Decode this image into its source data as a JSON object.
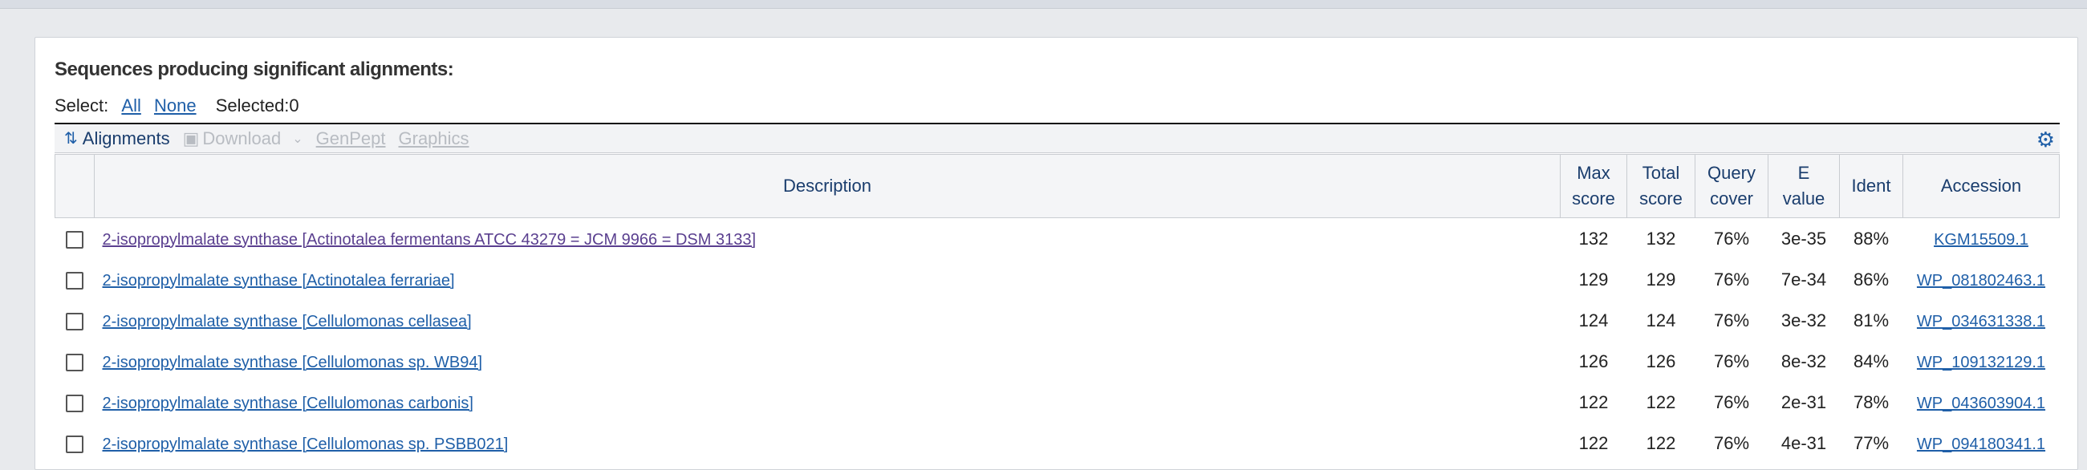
{
  "header": {
    "title": "Sequences producing significant alignments:"
  },
  "select": {
    "label": "Select:",
    "all": "All",
    "none": "None",
    "selected": "Selected:0"
  },
  "toolbar": {
    "alignments": "Alignments",
    "download": "Download",
    "genpept": "GenPept",
    "graphics": "Graphics",
    "icons": [
      "alignments-icon",
      "download-icon",
      "chevron-down-icon",
      "gear-icon"
    ]
  },
  "table": {
    "columns": {
      "description": "Description",
      "max_score": [
        "Max",
        "score"
      ],
      "total_score": [
        "Total",
        "score"
      ],
      "query_cover": [
        "Query",
        "cover"
      ],
      "e_value": [
        "E",
        "value"
      ],
      "ident": "Ident",
      "accession": "Accession"
    },
    "rows": [
      {
        "description": "2-isopropylmalate synthase [Actinotalea fermentans ATCC 43279 = JCM 9966 = DSM 3133]",
        "max_score": "132",
        "total_score": "132",
        "query_cover": "76%",
        "e_value": "3e-35",
        "ident": "88%",
        "accession": "KGM15509.1"
      },
      {
        "description": "2-isopropylmalate synthase [Actinotalea ferrariae]",
        "max_score": "129",
        "total_score": "129",
        "query_cover": "76%",
        "e_value": "7e-34",
        "ident": "86%",
        "accession": "WP_081802463.1"
      },
      {
        "description": "2-isopropylmalate synthase [Cellulomonas cellasea]",
        "max_score": "124",
        "total_score": "124",
        "query_cover": "76%",
        "e_value": "3e-32",
        "ident": "81%",
        "accession": "WP_034631338.1"
      },
      {
        "description": "2-isopropylmalate synthase [Cellulomonas sp. WB94]",
        "max_score": "126",
        "total_score": "126",
        "query_cover": "76%",
        "e_value": "8e-32",
        "ident": "84%",
        "accession": "WP_109132129.1"
      },
      {
        "description": "2-isopropylmalate synthase [Cellulomonas carbonis]",
        "max_score": "122",
        "total_score": "122",
        "query_cover": "76%",
        "e_value": "2e-31",
        "ident": "78%",
        "accession": "WP_043603904.1"
      },
      {
        "description": "2-isopropylmalate synthase [Cellulomonas sp. PSBB021]",
        "max_score": "122",
        "total_score": "122",
        "query_cover": "76%",
        "e_value": "4e-31",
        "ident": "77%",
        "accession": "WP_094180341.1"
      }
    ]
  },
  "colors": {
    "link": "#1f5fa8",
    "visited_link": "#5a3f8f",
    "header_text": "#1a3d6d",
    "disabled": "#b8bcc2"
  }
}
